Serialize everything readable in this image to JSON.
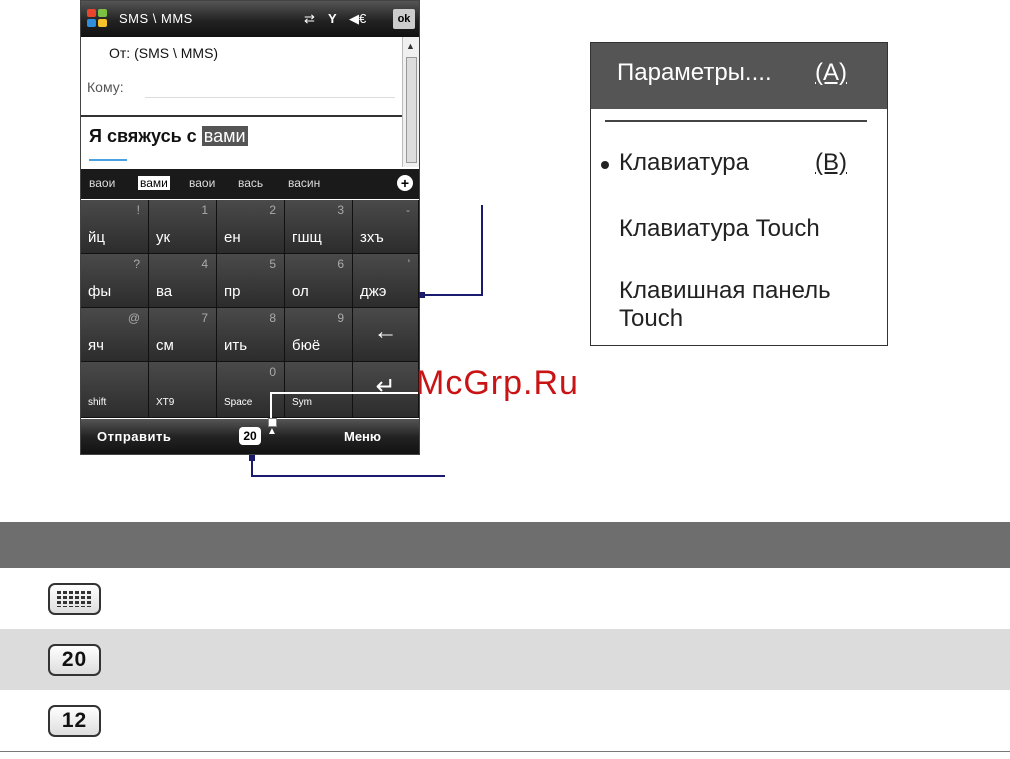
{
  "phone": {
    "app_title": "SMS \\ MMS",
    "ok_label": "ok",
    "status_icons": {
      "sync": "⇄",
      "signal": "Y",
      "volume": "◀€"
    },
    "from_label": "От:",
    "from_value": "(SMS \\ MMS)",
    "to_label": "Кому:",
    "body_prefix": "Я свяжусь с ",
    "body_selected": "вами",
    "suggestions": [
      "ваои",
      "вами",
      "ваои",
      "вась",
      "васин"
    ],
    "selected_suggestion_index": 1,
    "add_label": "+",
    "keys": [
      {
        "label": "йц",
        "num": "!"
      },
      {
        "label": "ук",
        "num": "1"
      },
      {
        "label": "ен",
        "num": "2"
      },
      {
        "label": "гшщ",
        "num": "3"
      },
      {
        "label": "зхъ",
        "num": "-"
      },
      {
        "label": "фы",
        "num": "?"
      },
      {
        "label": "ва",
        "num": "4"
      },
      {
        "label": "пр",
        "num": "5"
      },
      {
        "label": "ол",
        "num": "6"
      },
      {
        "label": "джэ",
        "num": "'"
      },
      {
        "label": "яч",
        "num": "@"
      },
      {
        "label": "см",
        "num": "7"
      },
      {
        "label": "ить",
        "num": "8"
      },
      {
        "label": "бюё",
        "num": "9"
      },
      {
        "label": "shift",
        "num": ""
      },
      {
        "label": "XT9",
        "num": ""
      },
      {
        "label": "Space",
        "num": "0"
      },
      {
        "label": "Sym",
        "num": ""
      }
    ],
    "backspace_glyph": "←",
    "enter_glyph": "↵",
    "send_label": "Отправить",
    "menu_label": "Меню",
    "mode_indicator": "20",
    "mode_arrow": "▲"
  },
  "popup": {
    "header_label": "Параметры....",
    "header_letter": "(A)",
    "items": [
      "Клавиатура",
      "Клавиатура Touch",
      "Клавишная панель Touch"
    ],
    "item_letter": "(B)"
  },
  "watermark": "McGrp.Ru",
  "table": {
    "rows": [
      {
        "icon": "keyboard-icon",
        "text": ""
      },
      {
        "icon": "mode-20-icon",
        "text": "20"
      },
      {
        "icon": "mode-12-icon",
        "text": "12"
      }
    ]
  },
  "colors": {
    "callout": "#1a1a6e",
    "watermark": "#c81414",
    "table_header": "#6e6e6e",
    "row_shade": "#dcdcdc"
  }
}
